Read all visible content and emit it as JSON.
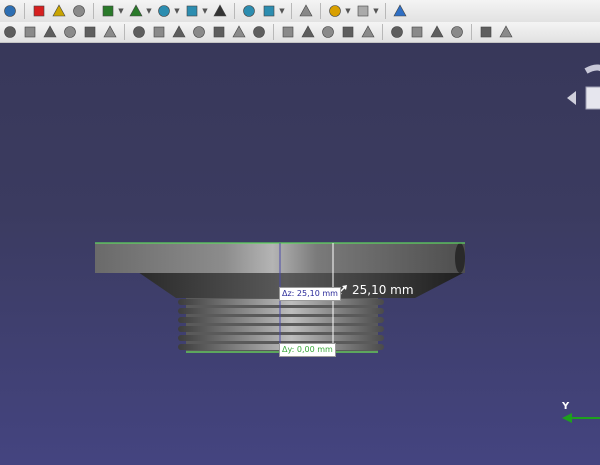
{
  "toolbar_row1": [
    {
      "icon": "macro-editor-icon",
      "color": "#2e6fb3"
    },
    {
      "icon": "record-macro-icon",
      "color": "#d62020"
    },
    {
      "icon": "macro-list-icon",
      "color": "#c9a400"
    },
    {
      "icon": "execute-macro-icon",
      "color": "#8a8a8a"
    },
    {
      "icon": "zoom-fit-all-icon",
      "color": "#2a7a2a"
    },
    {
      "icon": "zoom-fit-selection-icon",
      "color": "#2a7a2a"
    },
    {
      "icon": "view-isometric-icon",
      "color": "#2c8db0"
    },
    {
      "icon": "stereo-view-icon",
      "color": "#2c8db0"
    },
    {
      "icon": "draw-style-icon",
      "color": "#333333"
    },
    {
      "icon": "bounding-box-icon",
      "color": "#2c8db0"
    },
    {
      "icon": "measure-zoom-icon",
      "color": "#2c8db0"
    },
    {
      "icon": "measure-distance-icon",
      "color": "#888888"
    },
    {
      "icon": "undo-icon",
      "color": "#d9a000"
    },
    {
      "icon": "redo-icon",
      "color": "#aaaaaa"
    },
    {
      "icon": "refresh-icon",
      "color": "#2f6fc4"
    }
  ],
  "toolbar_row2": [
    "part-box-icon",
    "part-extrude-icon",
    "part-revolve-icon",
    "part-mirror-icon",
    "part-fillet-icon",
    "part-chamfer-icon",
    "part-cube-icon",
    "part-cylinder-icon",
    "part-sphere-icon",
    "part-cone-icon",
    "part-torus-icon",
    "part-tube-icon",
    "part-primitives-icon",
    "part-shapebuilder-icon",
    "boolean-icon",
    "cut-icon",
    "fuse-icon",
    "common-icon",
    "section-icon",
    "split-icon",
    "join-icon",
    "compound-icon",
    "check-geometry-icon",
    "defeaturing-icon"
  ],
  "measurement": {
    "main_label": "25,10 mm",
    "dz_label": "Δz: 25,10 mm",
    "dy_label": "Δy: 0,00 mm"
  },
  "axis": {
    "y_label": "Y"
  },
  "colors": {
    "viewport_top": "#38385a",
    "viewport_bottom": "#444480",
    "edge_highlight": "#5fd45f",
    "measure_line": "#ffffff",
    "dz_tag_text": "#2a2a9a",
    "dy_tag_text": "#3aa83a",
    "y_axis": "#1ea01e"
  }
}
